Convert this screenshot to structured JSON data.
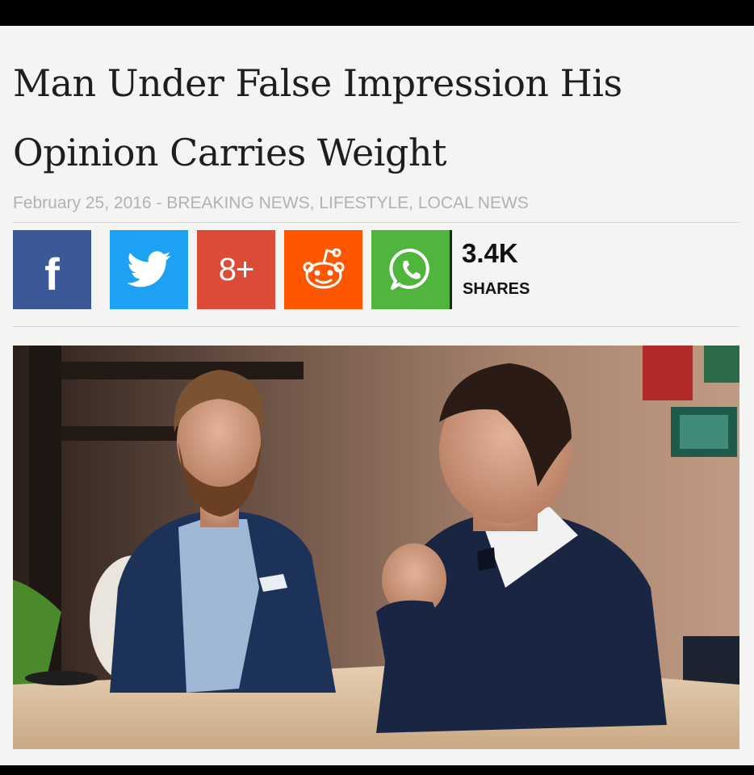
{
  "article": {
    "headline": "Man Under False Impression His Opinion Carries Weight",
    "meta": "February 25, 2016 - BREAKING NEWS, LIFESTYLE, LOCAL NEWS"
  },
  "share_bar": {
    "buttons": [
      {
        "network": "Facebook",
        "icon": "facebook-icon",
        "glyph": "f",
        "color": "#3b5998"
      },
      {
        "network": "Twitter",
        "icon": "twitter-bird-icon",
        "color": "#1da1f2"
      },
      {
        "network": "Google+",
        "icon": "google-plus-icon",
        "glyph": "8+",
        "color": "#dc4a38"
      },
      {
        "network": "Reddit",
        "icon": "reddit-alien-icon",
        "color": "#ff5700"
      },
      {
        "network": "WhatsApp",
        "icon": "whatsapp-icon",
        "color": "#4fb53d"
      }
    ],
    "count": "3.4K",
    "count_label": "SHARES"
  },
  "photo": {
    "icon": "article-photo"
  }
}
